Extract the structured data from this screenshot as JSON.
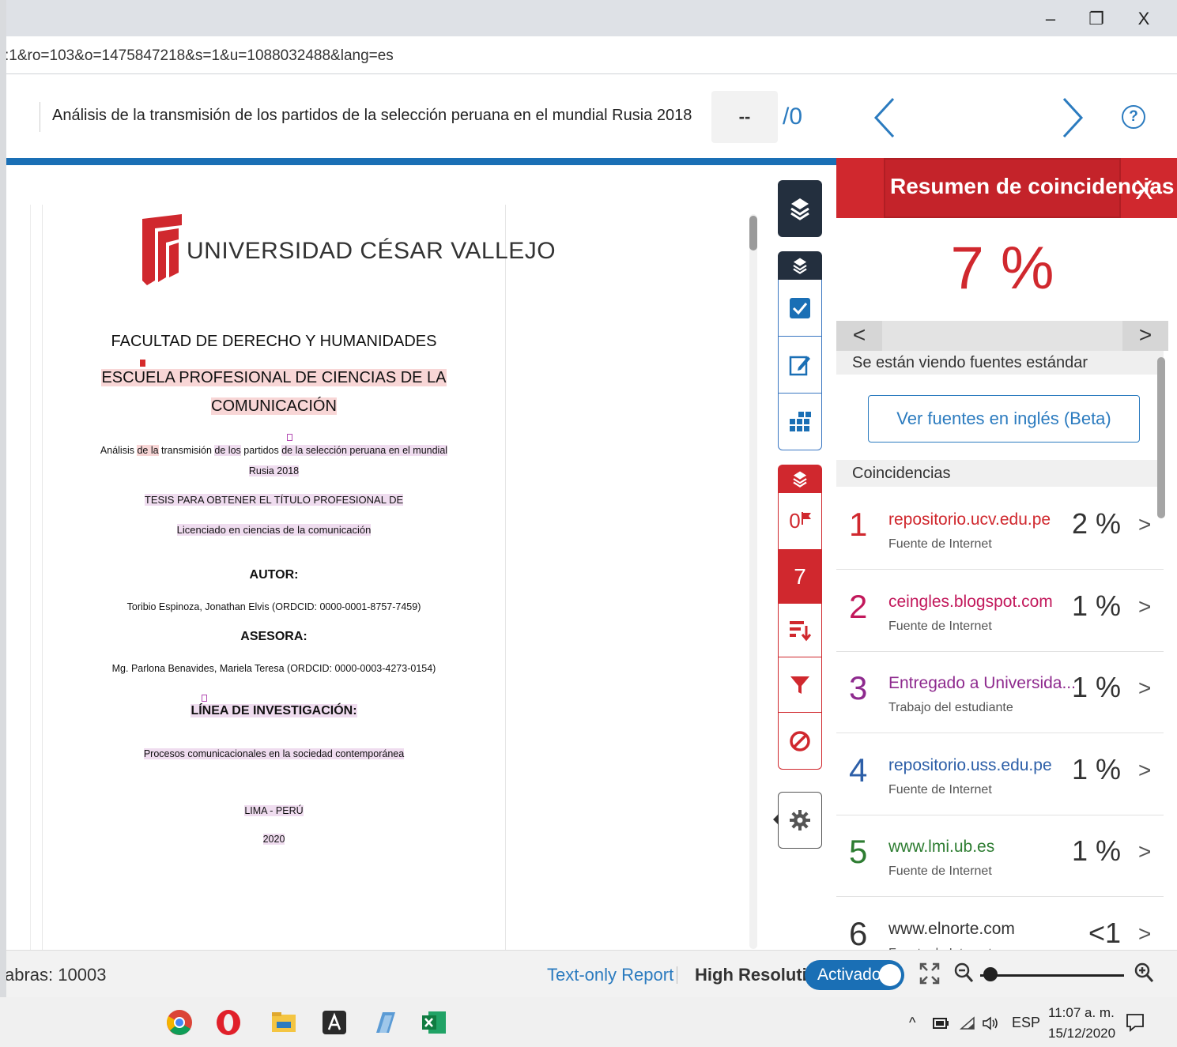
{
  "window": {
    "minimize": "–",
    "restore": "❐",
    "close": "X"
  },
  "address_bar": {
    "url": ":1&ro=103&o=1475847218&s=1&u=1088032488&lang=es"
  },
  "header": {
    "doc_title": "Análisis de la transmisión de los partidos de la selección peruana en el mundial Rusia 2018",
    "page_current": "--",
    "page_total": "/0",
    "help": "?"
  },
  "document": {
    "university": "UNIVERSIDAD CÉSAR VALLEJO",
    "faculty": "FACULTAD DE DERECHO Y HUMANIDADES",
    "school_line1": "ESCUELA PROFESIONAL DE CIENCIAS DE LA",
    "school_line2": "COMUNICACIÓN",
    "thesis_title_a": "Análisis ",
    "thesis_title_b": "de la",
    "thesis_title_c": " transmisión ",
    "thesis_title_d": "de los",
    "thesis_title_e": " partidos ",
    "thesis_title_f": "de la selección peruana en el mundial",
    "thesis_title_line2": "Rusia 2018",
    "thesis_for": "TESIS PARA OBTENER EL TÍTULO PROFESIONAL DE",
    "degree": "Licenciado en ciencias de la comunicación",
    "author_label": "AUTOR:",
    "author": "Toribio Espinoza, Jonathan Elvis (ORDCID: 0000-0001-8757-7459)",
    "advisor_label": "ASESORA:",
    "advisor": "Mg. Parlona Benavides, Mariela Teresa (ORDCID: 0000-0003-4273-0154)",
    "research_label": "LÍNEA DE INVESTIGACIÓN:",
    "research_line": "Procesos comunicacionales en la sociedad contemporánea",
    "place": "LIMA - PERÚ",
    "year": "2020",
    "mark_count_red": "7"
  },
  "tools": {
    "flags_count": "0",
    "match_count": "7"
  },
  "panel": {
    "title": "Resumen de coincidencias",
    "close": "X",
    "similarity": "7 %",
    "prev": "<",
    "next": ">",
    "sources_info": "Se están viendo fuentes estándar",
    "english_button": "Ver fuentes en inglés (Beta)",
    "matches_header": "Coincidencias",
    "matches": [
      {
        "num": "1",
        "name": "repositorio.ucv.edu.pe",
        "type": "Fuente de Internet",
        "pct": "2 %",
        "color": "#d0282e"
      },
      {
        "num": "2",
        "name": "ceingles.blogspot.com",
        "type": "Fuente de Internet",
        "pct": "1 %",
        "color": "#c2185b"
      },
      {
        "num": "3",
        "name": "Entregado a Universida...",
        "type": "Trabajo del estudiante",
        "pct": "1 %",
        "color": "#8e2a8e"
      },
      {
        "num": "4",
        "name": "repositorio.uss.edu.pe",
        "type": "Fuente de Internet",
        "pct": "1 %",
        "color": "#2d5fa8"
      },
      {
        "num": "5",
        "name": "www.lmi.ub.es",
        "type": "Fuente de Internet",
        "pct": "1 %",
        "color": "#2e7d32"
      },
      {
        "num": "6",
        "name": "www.elnorte.com",
        "type": "Fuente de Internet",
        "pct": "<1 %",
        "color": "#333333"
      }
    ]
  },
  "status": {
    "words": "abras: 10003",
    "text_only": "Text-only Report",
    "high_res": "High Resolution",
    "toggle": "Activado"
  },
  "taskbar": {
    "tray_up": "^",
    "lang": "ESP",
    "time": "11:07 a. m.",
    "date": "15/12/2020"
  },
  "colors": {
    "brand_red": "#d0282e",
    "accent_blue": "#1a6fb5",
    "link_blue": "#2b7bbf"
  }
}
